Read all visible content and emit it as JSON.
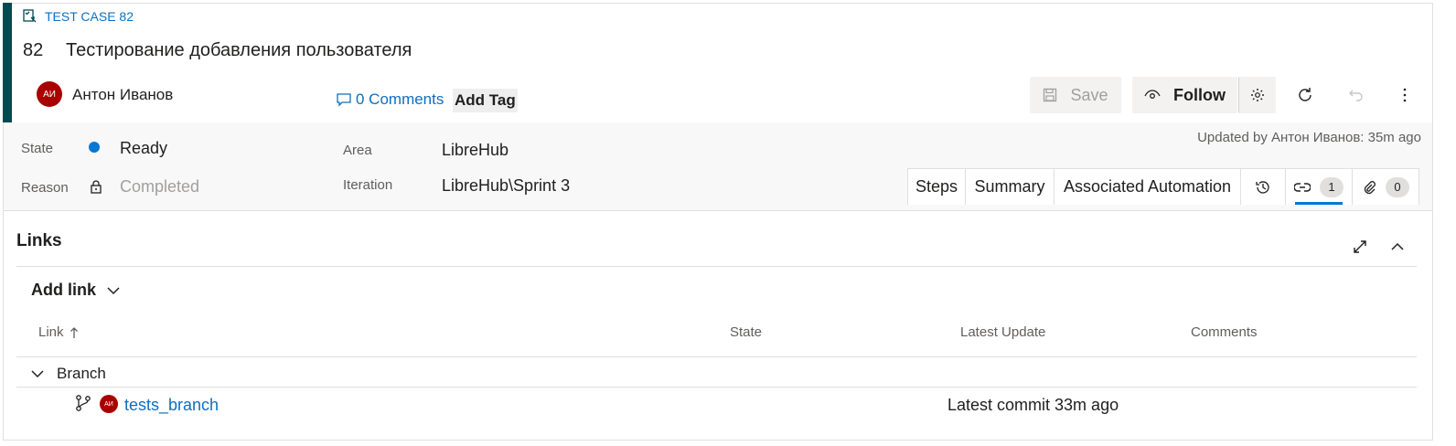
{
  "header": {
    "type_label": "TEST CASE 82",
    "id": "82",
    "title": "Тестирование добавления пользователя",
    "assignee": {
      "initials": "АИ",
      "name": "Антон Иванов"
    },
    "comments_label": "0 Comments",
    "add_tag_label": "Add Tag"
  },
  "toolbar": {
    "save_label": "Save",
    "follow_label": "Follow"
  },
  "fields": {
    "state_label": "State",
    "state_value": "Ready",
    "reason_label": "Reason",
    "reason_value": "Completed",
    "area_label": "Area",
    "area_value": "LibreHub",
    "iteration_label": "Iteration",
    "iteration_value": "LibreHub\\Sprint 3",
    "updated_text": "Updated by Антон Иванов: 35m ago"
  },
  "tabs": {
    "steps": "Steps",
    "summary": "Summary",
    "automation": "Associated Automation",
    "links_count": "1",
    "attachments_count": "0"
  },
  "links_section": {
    "title": "Links",
    "add_link_label": "Add link",
    "columns": {
      "link": "Link",
      "state": "State",
      "latest_update": "Latest Update",
      "comments": "Comments"
    },
    "group_label": "Branch",
    "rows": [
      {
        "avatar_initials": "АИ",
        "name": "tests_branch",
        "latest_update": "Latest commit 33m ago"
      }
    ]
  },
  "colors": {
    "accent": "#004b50",
    "link": "#106ebe",
    "state_dot": "#0078d4",
    "avatar": "#a80000"
  }
}
